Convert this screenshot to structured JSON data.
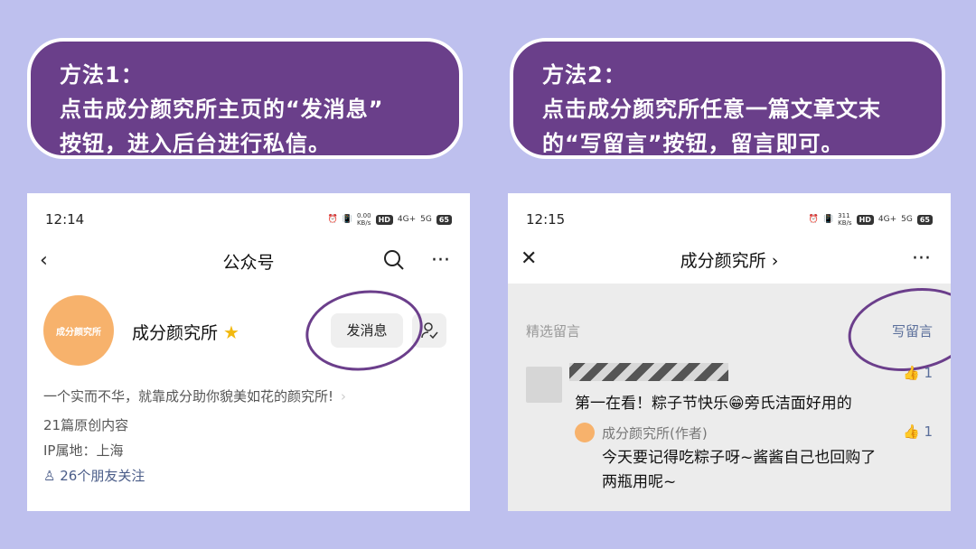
{
  "banner1": {
    "line1": "方法1：",
    "line2": "点击成分颜究所主页的“发消息”",
    "line3": "按钮，进入后台进行私信。"
  },
  "banner2": {
    "line1": "方法2：",
    "line2": "点击成分颜究所任意一篇文章文末",
    "line3": "的“写留言”按钮，留言即可。"
  },
  "screen1": {
    "status": {
      "time": "12:14",
      "speed_value": "0.00",
      "speed_unit": "KB/s",
      "hd": "HD",
      "net4g": "4G+",
      "net5g": "5G",
      "battery": "65"
    },
    "nav": {
      "title": "公众号"
    },
    "account": {
      "avatar_text": "成分颜究所",
      "name": "成分颜究所",
      "message_button": "发消息",
      "description": "一个实而不华，就靠成分助你貌美如花的颜究所!",
      "articles": "21篇原创内容",
      "ip_location": "IP属地：上海",
      "friends_following": "26个朋友关注"
    }
  },
  "screen2": {
    "status": {
      "time": "12:15",
      "speed_value": "311",
      "speed_unit": "KB/s",
      "hd": "HD",
      "net4g": "4G+",
      "net5g": "5G",
      "battery": "65"
    },
    "nav": {
      "title": "成分颜究所 ›"
    },
    "comments": {
      "section_label": "精选留言",
      "write_label": "写留言",
      "comment": {
        "likes": "1",
        "text": "第一在看！粽子节快乐😁旁氏洁面好用的"
      },
      "reply": {
        "author": "成分颜究所(作者)",
        "likes": "1",
        "line1": "今天要记得吃粽子呀~酱酱自己也回购了",
        "line2": "两瓶用呢~"
      }
    }
  },
  "colors": {
    "background": "#bec0ee",
    "banner": "#6a3f8a",
    "annotation_circle": "#6b3e8b",
    "avatar": "#f7b26c",
    "link": "#5a6e9a"
  }
}
